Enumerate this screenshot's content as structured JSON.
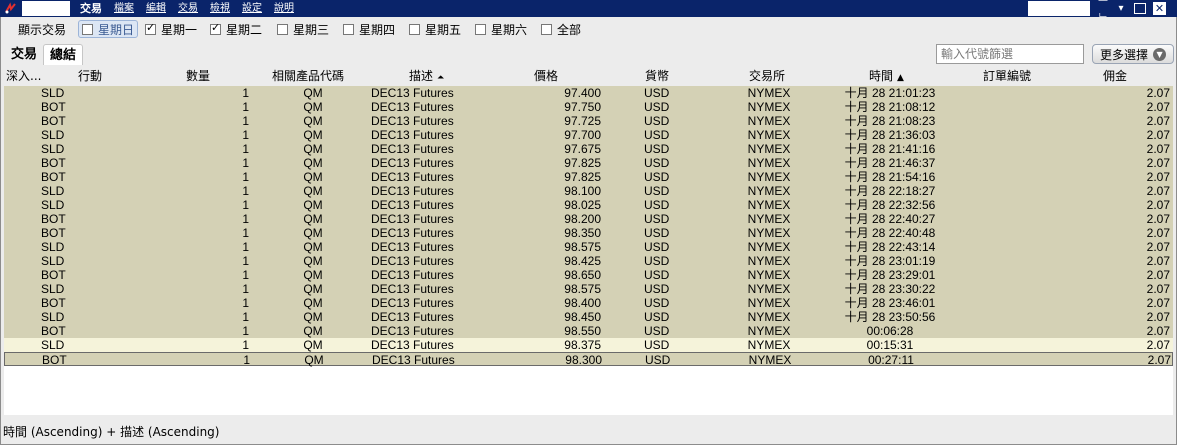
{
  "menubar": {
    "items": [
      "交易",
      "檔案",
      "編輯",
      "交易",
      "檢視",
      "設定",
      "說明"
    ],
    "controls": [
      "pin",
      "restore",
      "close"
    ]
  },
  "daybar": {
    "label": "顯示交易",
    "days": [
      {
        "label": "星期日",
        "checked": false,
        "focused": true
      },
      {
        "label": "星期一",
        "checked": true,
        "focused": false
      },
      {
        "label": "星期二",
        "checked": true,
        "focused": false
      },
      {
        "label": "星期三",
        "checked": false,
        "focused": false
      },
      {
        "label": "星期四",
        "checked": false,
        "focused": false
      },
      {
        "label": "星期五",
        "checked": false,
        "focused": false
      },
      {
        "label": "星期六",
        "checked": false,
        "focused": false
      },
      {
        "label": "全部",
        "checked": false,
        "focused": false
      }
    ]
  },
  "tabs": [
    {
      "label": "交易",
      "active": false
    },
    {
      "label": "總結",
      "active": true
    }
  ],
  "filter": {
    "placeholder": "輸入代號篩選",
    "value": ""
  },
  "more_button": {
    "label": "更多選擇"
  },
  "table": {
    "headers": {
      "depth": "深入...",
      "action": "行動",
      "quantity": "數量",
      "symbol": "相關產品代碼",
      "description": "描述",
      "price": "價格",
      "currency": "貨幣",
      "exchange": "交易所",
      "time": "時間",
      "order_id": "訂單編號",
      "commission": "佣金"
    },
    "rows": [
      {
        "action": "SLD",
        "qty": "1",
        "symbol": "QM",
        "desc": "DEC13 Futures",
        "price": "97.400",
        "currency": "USD",
        "exchange": "NYMEX",
        "time": "十月 28 21:01:23",
        "commission": "2.07"
      },
      {
        "action": "BOT",
        "qty": "1",
        "symbol": "QM",
        "desc": "DEC13 Futures",
        "price": "97.750",
        "currency": "USD",
        "exchange": "NYMEX",
        "time": "十月 28 21:08:12",
        "commission": "2.07"
      },
      {
        "action": "BOT",
        "qty": "1",
        "symbol": "QM",
        "desc": "DEC13 Futures",
        "price": "97.725",
        "currency": "USD",
        "exchange": "NYMEX",
        "time": "十月 28 21:08:23",
        "commission": "2.07"
      },
      {
        "action": "SLD",
        "qty": "1",
        "symbol": "QM",
        "desc": "DEC13 Futures",
        "price": "97.700",
        "currency": "USD",
        "exchange": "NYMEX",
        "time": "十月 28 21:36:03",
        "commission": "2.07"
      },
      {
        "action": "SLD",
        "qty": "1",
        "symbol": "QM",
        "desc": "DEC13 Futures",
        "price": "97.675",
        "currency": "USD",
        "exchange": "NYMEX",
        "time": "十月 28 21:41:16",
        "commission": "2.07"
      },
      {
        "action": "BOT",
        "qty": "1",
        "symbol": "QM",
        "desc": "DEC13 Futures",
        "price": "97.825",
        "currency": "USD",
        "exchange": "NYMEX",
        "time": "十月 28 21:46:37",
        "commission": "2.07"
      },
      {
        "action": "BOT",
        "qty": "1",
        "symbol": "QM",
        "desc": "DEC13 Futures",
        "price": "97.825",
        "currency": "USD",
        "exchange": "NYMEX",
        "time": "十月 28 21:54:16",
        "commission": "2.07"
      },
      {
        "action": "SLD",
        "qty": "1",
        "symbol": "QM",
        "desc": "DEC13 Futures",
        "price": "98.100",
        "currency": "USD",
        "exchange": "NYMEX",
        "time": "十月 28 22:18:27",
        "commission": "2.07"
      },
      {
        "action": "SLD",
        "qty": "1",
        "symbol": "QM",
        "desc": "DEC13 Futures",
        "price": "98.025",
        "currency": "USD",
        "exchange": "NYMEX",
        "time": "十月 28 22:32:56",
        "commission": "2.07"
      },
      {
        "action": "BOT",
        "qty": "1",
        "symbol": "QM",
        "desc": "DEC13 Futures",
        "price": "98.200",
        "currency": "USD",
        "exchange": "NYMEX",
        "time": "十月 28 22:40:27",
        "commission": "2.07"
      },
      {
        "action": "BOT",
        "qty": "1",
        "symbol": "QM",
        "desc": "DEC13 Futures",
        "price": "98.350",
        "currency": "USD",
        "exchange": "NYMEX",
        "time": "十月 28 22:40:48",
        "commission": "2.07"
      },
      {
        "action": "SLD",
        "qty": "1",
        "symbol": "QM",
        "desc": "DEC13 Futures",
        "price": "98.575",
        "currency": "USD",
        "exchange": "NYMEX",
        "time": "十月 28 22:43:14",
        "commission": "2.07"
      },
      {
        "action": "SLD",
        "qty": "1",
        "symbol": "QM",
        "desc": "DEC13 Futures",
        "price": "98.425",
        "currency": "USD",
        "exchange": "NYMEX",
        "time": "十月 28 23:01:19",
        "commission": "2.07"
      },
      {
        "action": "BOT",
        "qty": "1",
        "symbol": "QM",
        "desc": "DEC13 Futures",
        "price": "98.650",
        "currency": "USD",
        "exchange": "NYMEX",
        "time": "十月 28 23:29:01",
        "commission": "2.07"
      },
      {
        "action": "SLD",
        "qty": "1",
        "symbol": "QM",
        "desc": "DEC13 Futures",
        "price": "98.575",
        "currency": "USD",
        "exchange": "NYMEX",
        "time": "十月 28 23:30:22",
        "commission": "2.07"
      },
      {
        "action": "BOT",
        "qty": "1",
        "symbol": "QM",
        "desc": "DEC13 Futures",
        "price": "98.400",
        "currency": "USD",
        "exchange": "NYMEX",
        "time": "十月 28 23:46:01",
        "commission": "2.07"
      },
      {
        "action": "SLD",
        "qty": "1",
        "symbol": "QM",
        "desc": "DEC13 Futures",
        "price": "98.450",
        "currency": "USD",
        "exchange": "NYMEX",
        "time": "十月 28 23:50:56",
        "commission": "2.07"
      },
      {
        "action": "BOT",
        "qty": "1",
        "symbol": "QM",
        "desc": "DEC13 Futures",
        "price": "98.550",
        "currency": "USD",
        "exchange": "NYMEX",
        "time": "00:06:28",
        "commission": "2.07"
      },
      {
        "action": "SLD",
        "qty": "1",
        "symbol": "QM",
        "desc": "DEC13 Futures",
        "price": "98.375",
        "currency": "USD",
        "exchange": "NYMEX",
        "time": "00:15:31",
        "commission": "2.07",
        "state": "sel"
      },
      {
        "action": "BOT",
        "qty": "1",
        "symbol": "QM",
        "desc": "DEC13 Futures",
        "price": "98.300",
        "currency": "USD",
        "exchange": "NYMEX",
        "time": "00:27:11",
        "commission": "2.07",
        "state": "cur"
      }
    ]
  },
  "status": {
    "sort_text": "時間 (Ascending)  +  描述 (Ascending)"
  },
  "colors": {
    "titlebar": "#0a246a",
    "row": "#d4d1b5",
    "row_selected": "#f5f3da",
    "panel": "#ececec"
  }
}
